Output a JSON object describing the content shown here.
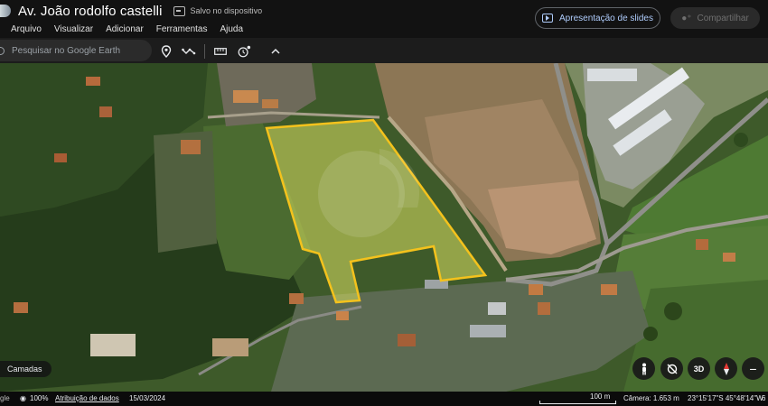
{
  "header": {
    "title": "Av. João rodolfo castelli",
    "save_status": "Salvo no dispositivo",
    "menu": [
      "Arquivo",
      "Visualizar",
      "Adicionar",
      "Ferramentas",
      "Ajuda"
    ],
    "slides_button": "Apresentação de slides",
    "share_button": "Compartilhar"
  },
  "search": {
    "placeholder": "Pesquisar no Google Earth"
  },
  "toolbar": {
    "icons": [
      "map-pin-icon",
      "path-icon",
      "ruler-icon",
      "historical-imagery-icon",
      "collapse-chevron-icon"
    ]
  },
  "map": {
    "polygon_outline_color": "#f4c21c",
    "polygon_fill_color": "#c8d84a"
  },
  "controls": {
    "layers_label": "Camadas",
    "view_3d": "3D",
    "zoom_out": "−"
  },
  "status": {
    "brand": "gle",
    "zoom": "100%",
    "attribution": "Atribuição de dados",
    "date": "15/03/2024",
    "scale": "100 m",
    "camera": "Câmera: 1.653 m",
    "coords": "23°15'17\"S 45°48'14\"W",
    "elevation": "6"
  }
}
